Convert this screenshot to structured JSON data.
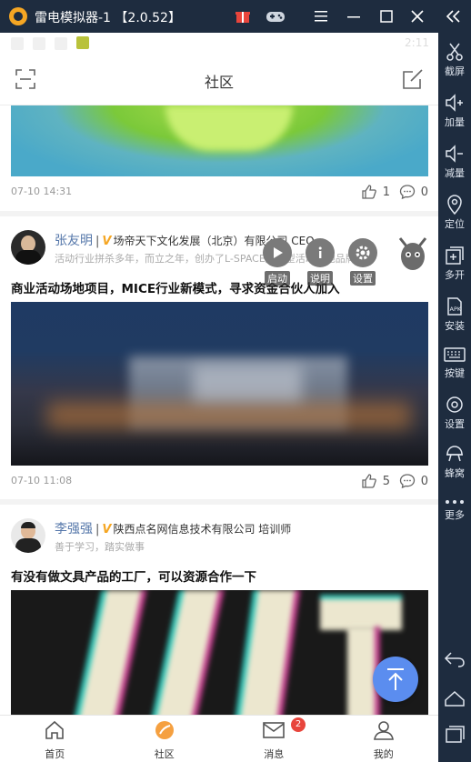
{
  "window": {
    "title": "雷电模拟器-1 【2.0.52】"
  },
  "sidebar": {
    "items": [
      {
        "label": "截屏",
        "icon": "scissors-icon"
      },
      {
        "label": "加量",
        "icon": "volume-up-icon"
      },
      {
        "label": "减量",
        "icon": "volume-down-icon"
      },
      {
        "label": "定位",
        "icon": "location-icon"
      },
      {
        "label": "多开",
        "icon": "multi-window-icon"
      },
      {
        "label": "安装",
        "icon": "apk-install-icon"
      },
      {
        "label": "按键",
        "icon": "keyboard-icon"
      },
      {
        "label": "设置",
        "icon": "gear-icon"
      },
      {
        "label": "蜂窝",
        "icon": "hive-icon"
      },
      {
        "label": "更多",
        "icon": "more-dots-icon"
      }
    ]
  },
  "status": {
    "time": "2:11"
  },
  "appbar": {
    "title": "社区"
  },
  "posts": [
    {
      "date": "07-10 14:31",
      "likes": "1",
      "comments": "0"
    },
    {
      "author": "张友明",
      "company": "场帝天下文化发展（北京）有限公司 CEO",
      "bio": "活动行业拼杀多年，而立之年，创办了L-SPACE服务型活动场地品牌",
      "title": "商业活动场地项目，MICE行业新模式，寻求资金合伙人加入",
      "date": "07-10 11:08",
      "likes": "5",
      "comments": "0"
    },
    {
      "author": "李强强",
      "company": "陕西点名网信息技术有限公司 培训师",
      "bio": "善于学习，踏实做事",
      "title": "有没有做文具产品的工厂，可以资源合作一下"
    }
  ],
  "overlay": {
    "start": "启动",
    "info": "说明",
    "settings": "设置"
  },
  "tabs": [
    {
      "label": "首页",
      "icon": "home-icon"
    },
    {
      "label": "社区",
      "icon": "community-icon"
    },
    {
      "label": "消息",
      "icon": "mail-icon",
      "badge": "2"
    },
    {
      "label": "我的",
      "icon": "user-icon"
    }
  ],
  "colors": {
    "accent": "#f5a623",
    "fab": "#5b8def",
    "badge": "#e8453c",
    "name": "#5577aa"
  }
}
